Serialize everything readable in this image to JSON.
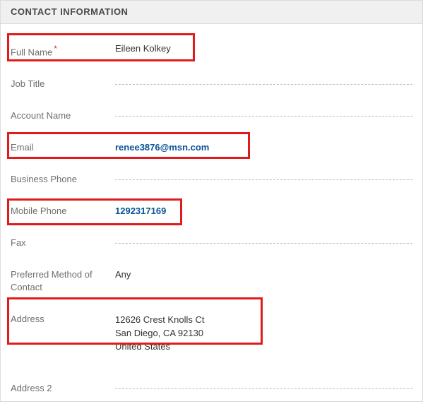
{
  "section_title": "CONTACT INFORMATION",
  "fields": {
    "full_name": {
      "label": "Full Name",
      "value": "Eileen Kolkey",
      "required": true,
      "link": false,
      "empty": false
    },
    "job_title": {
      "label": "Job Title",
      "value": "",
      "required": false,
      "link": false,
      "empty": true
    },
    "account": {
      "label": "Account Name",
      "value": "",
      "required": false,
      "link": false,
      "empty": true
    },
    "email": {
      "label": "Email",
      "value": "renee3876@msn.com",
      "required": false,
      "link": true,
      "empty": false
    },
    "biz_phone": {
      "label": "Business Phone",
      "value": "",
      "required": false,
      "link": false,
      "empty": true
    },
    "mob_phone": {
      "label": "Mobile Phone",
      "value": "1292317169",
      "required": false,
      "link": true,
      "empty": false
    },
    "fax": {
      "label": "Fax",
      "value": "",
      "required": false,
      "link": false,
      "empty": true
    },
    "pref_method": {
      "label": "Preferred Method of Contact",
      "value": "Any",
      "required": false,
      "link": false,
      "empty": false
    },
    "address": {
      "label": "Address",
      "lines": [
        "12626 Crest Knolls Ct",
        "San Diego, CA 92130",
        "United States"
      ],
      "required": false,
      "link": false,
      "empty": false
    },
    "address2": {
      "label": "Address 2",
      "value": "",
      "required": false,
      "link": false,
      "empty": true
    }
  },
  "required_marker": "*"
}
